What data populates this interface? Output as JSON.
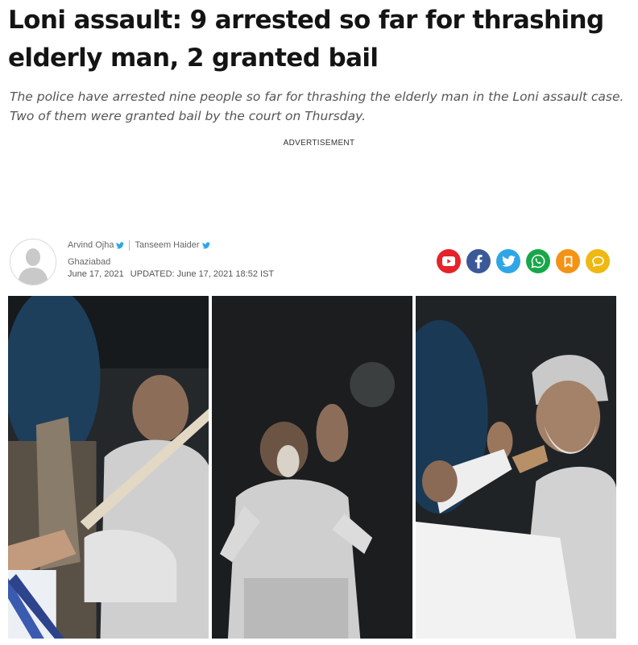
{
  "article": {
    "headline": "Loni assault: 9 arrested so far for thrashing elderly man, 2 granted bail",
    "summary": "The police have arrested nine people so far for thrashing the elderly man in the Loni assault case. Two of them were granted bail by the court on Thursday.",
    "advertisement_label": "ADVERTISEMENT"
  },
  "byline": {
    "authors": [
      "Arvind Ojha",
      "Tanseem Haider"
    ],
    "location": "Ghaziabad",
    "published": "June 17, 2021",
    "updated": "UPDATED: June 17, 2021 18:52 IST"
  },
  "share": {
    "buttons": [
      {
        "icon": "youtube-icon",
        "color": "#e5232b"
      },
      {
        "icon": "facebook-icon",
        "color": "#3b5998"
      },
      {
        "icon": "twitter-icon",
        "color": "#2ea6e6"
      },
      {
        "icon": "whatsapp-icon",
        "color": "#18a64a"
      },
      {
        "icon": "bookmark-icon",
        "color": "#f39316"
      },
      {
        "icon": "comment-icon",
        "color": "#efb812"
      }
    ]
  },
  "photo": {
    "panels": [
      "video-still-1",
      "video-still-2",
      "video-still-3"
    ]
  }
}
